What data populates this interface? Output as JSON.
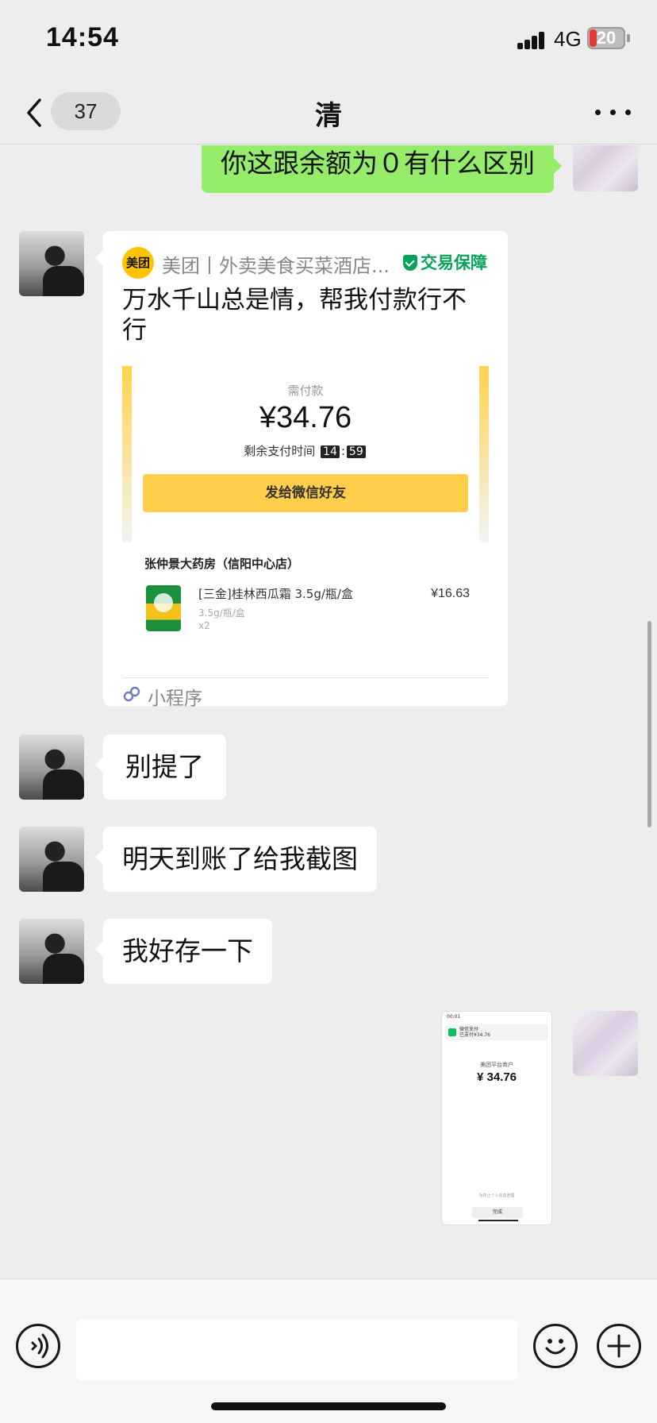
{
  "status_bar": {
    "time": "14:54",
    "network": "4G",
    "battery": "20",
    "battery_level": 0.2
  },
  "nav": {
    "unread_count": "37",
    "title": "清",
    "back_icon": "chevron-left-icon",
    "more_icon": "more-dots-icon"
  },
  "messages": {
    "m1": {
      "text": "你这跟余额为０有什么区别"
    },
    "mini_program": {
      "app_name": "美团丨外卖美食买菜酒店...",
      "logo_text": "美团",
      "guarantee": "交易保障",
      "title": "万水千山总是情，帮我付款行不行",
      "pay_label": "需付款",
      "amount": "¥34.76",
      "timer_label": "剩余支付时间",
      "timer_min": "14",
      "timer_sep": ":",
      "timer_sec": "59",
      "button_label": "发给微信好友",
      "store": "张仲景大药房（信阳中心店）",
      "product_name": "[三金]桂林西瓜霜 3.5g/瓶/盒",
      "product_spec": "3.5g/瓶/盒",
      "product_qty": "x2",
      "product_price": "¥16.63",
      "footer_label": "小程序"
    },
    "m3": {
      "text": "别提了"
    },
    "m4": {
      "text": "明天到账了给我截图"
    },
    "m5": {
      "text": "我好存一下"
    },
    "image": {
      "status": "00:01",
      "notify_title": "微信支付",
      "notify_body": "已支付¥34.76",
      "merchant": "美团平台商户",
      "amount": "¥ 34.76",
      "note": "为防止个人信息泄露",
      "done": "完成"
    }
  },
  "colors": {
    "my_bubble": "#95ec69",
    "friend_bubble": "#ffffff",
    "background": "#ededed",
    "guarantee_green": "#07a35a",
    "pay_button": "#ffce4a"
  },
  "input_bar": {
    "placeholder": "",
    "voice_icon": "voice-icon",
    "emoji_icon": "emoji-icon",
    "plus_icon": "plus-icon"
  }
}
